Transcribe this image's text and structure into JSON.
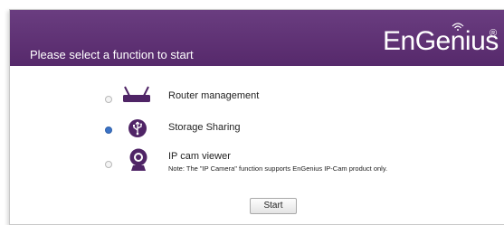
{
  "header": {
    "title": "Please select a function to start",
    "logo_text": "EnGenius",
    "logo_mark": "®"
  },
  "options": [
    {
      "label": "Router management",
      "icon": "router-icon",
      "selected": false
    },
    {
      "label": "Storage Sharing",
      "icon": "usb-storage-icon",
      "selected": true
    },
    {
      "label": "IP cam viewer",
      "icon": "webcam-icon",
      "selected": false,
      "note": "Note: The \"IP Camera\" function supports EnGenius IP-Cam product only."
    }
  ],
  "start_button": {
    "label": "Start"
  },
  "colors": {
    "header": "#5e2f74",
    "icon": "#4f2466",
    "radio_selected": "#3b73c6"
  }
}
